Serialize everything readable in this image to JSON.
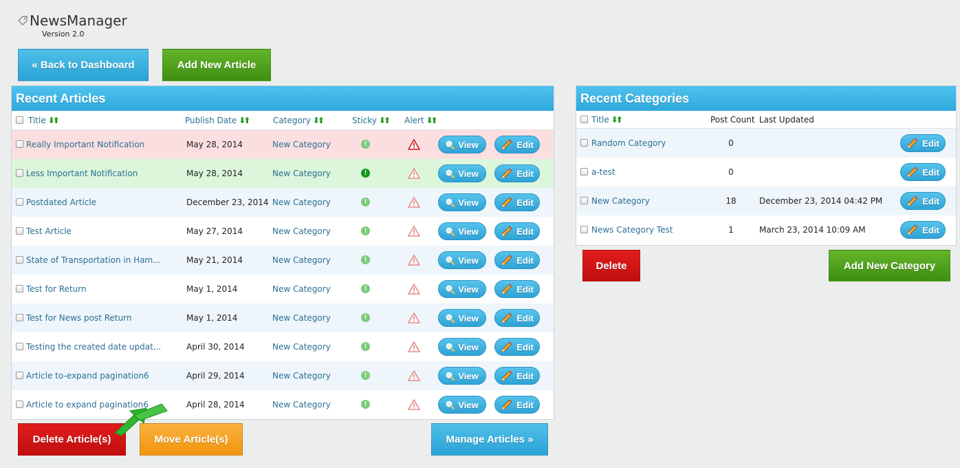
{
  "app": {
    "title": "NewsManager",
    "version": "Version 2.0"
  },
  "top_buttons": {
    "back": "« Back to Dashboard",
    "add_article": "Add New Article"
  },
  "articles": {
    "heading": "Recent Articles",
    "columns": {
      "title": "Title",
      "publish_date": "Publish Date",
      "category": "Category",
      "sticky": "Sticky",
      "alert": "Alert"
    },
    "view_label": "View",
    "edit_label": "Edit",
    "rows": [
      {
        "title": "Really Important Notification",
        "date": "May 28, 2014",
        "category": "New Category",
        "sticky": false,
        "alert": true,
        "tone": "red"
      },
      {
        "title": "Less Important Notification",
        "date": "May 28, 2014",
        "category": "New Category",
        "sticky": true,
        "alert": false,
        "tone": "green"
      },
      {
        "title": "Postdated Article",
        "date": "December 23, 2014",
        "category": "New Category",
        "sticky": false,
        "alert": false,
        "tone": "alt"
      },
      {
        "title": "Test Article",
        "date": "May 27, 2014",
        "category": "New Category",
        "sticky": false,
        "alert": false,
        "tone": ""
      },
      {
        "title": "State of Transportation in Ham...",
        "date": "May 21, 2014",
        "category": "New Category",
        "sticky": false,
        "alert": false,
        "tone": "alt"
      },
      {
        "title": "Test for Return",
        "date": "May 1, 2014",
        "category": "New Category",
        "sticky": false,
        "alert": false,
        "tone": ""
      },
      {
        "title": "Test for News post Return",
        "date": "May 1, 2014",
        "category": "New Category",
        "sticky": false,
        "alert": false,
        "tone": "alt"
      },
      {
        "title": "Testing the created date updat...",
        "date": "April 30, 2014",
        "category": "New Category",
        "sticky": false,
        "alert": false,
        "tone": ""
      },
      {
        "title": "Article to-expand pagination6",
        "date": "April 29, 2014",
        "category": "New Category",
        "sticky": false,
        "alert": false,
        "tone": "alt"
      },
      {
        "title": "Article to expand pagination6",
        "date": "April 28, 2014",
        "category": "New Category",
        "sticky": false,
        "alert": false,
        "tone": ""
      }
    ],
    "actions": {
      "delete": "Delete Article(s)",
      "move": "Move Article(s)",
      "manage": "Manage Articles »"
    }
  },
  "categories": {
    "heading": "Recent Categories",
    "columns": {
      "title": "Title",
      "post_count": "Post Count",
      "last_updated": "Last Updated"
    },
    "edit_label": "Edit",
    "rows": [
      {
        "title": "Random Category",
        "count": "0",
        "updated": "",
        "tone": "alt"
      },
      {
        "title": "a-test",
        "count": "0",
        "updated": "",
        "tone": ""
      },
      {
        "title": "New Category",
        "count": "18",
        "updated": "December 23, 2014 04:42 PM",
        "tone": "alt"
      },
      {
        "title": "News Category Test",
        "count": "1",
        "updated": "March 23, 2014 10:09 AM",
        "tone": ""
      }
    ],
    "actions": {
      "delete": "Delete",
      "add": "Add New Category"
    }
  },
  "icons": {
    "app": "tag-icon",
    "view": "magnifier-icon",
    "edit": "pencil-icon",
    "sticky": "exclamation-circle-icon",
    "alert": "warning-triangle-icon",
    "sort": "sort-arrows-icon",
    "pointer": "green-arrow-icon"
  },
  "colors": {
    "accent_blue": "#2ea8dc",
    "green": "#3f8e12",
    "red": "#c20e0e",
    "orange": "#f0950f",
    "sticky_on": "#12961a",
    "sticky_off": "#7ccb7c",
    "alert_on": "#d01818",
    "alert_off": "#e58a8a"
  }
}
